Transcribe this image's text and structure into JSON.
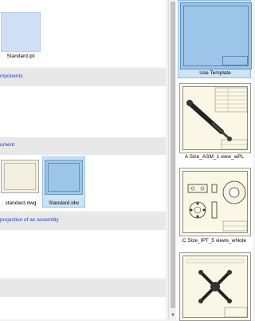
{
  "left": {
    "sections": [
      {
        "header": ""
      },
      {
        "header": "mponents"
      },
      {
        "header": "ument"
      },
      {
        "header": "projection of an assembly"
      },
      {
        "header": ""
      }
    ],
    "files": {
      "ipt": "Standard.ipt",
      "dwg": "standard.dwg",
      "idw": "Standard.idw"
    }
  },
  "templates": [
    {
      "label": "Use Template"
    },
    {
      "label": "A Size_ASM_1 view_wPL"
    },
    {
      "label": "C Size_IPT_5 views_wNote"
    },
    {
      "label": ""
    }
  ]
}
